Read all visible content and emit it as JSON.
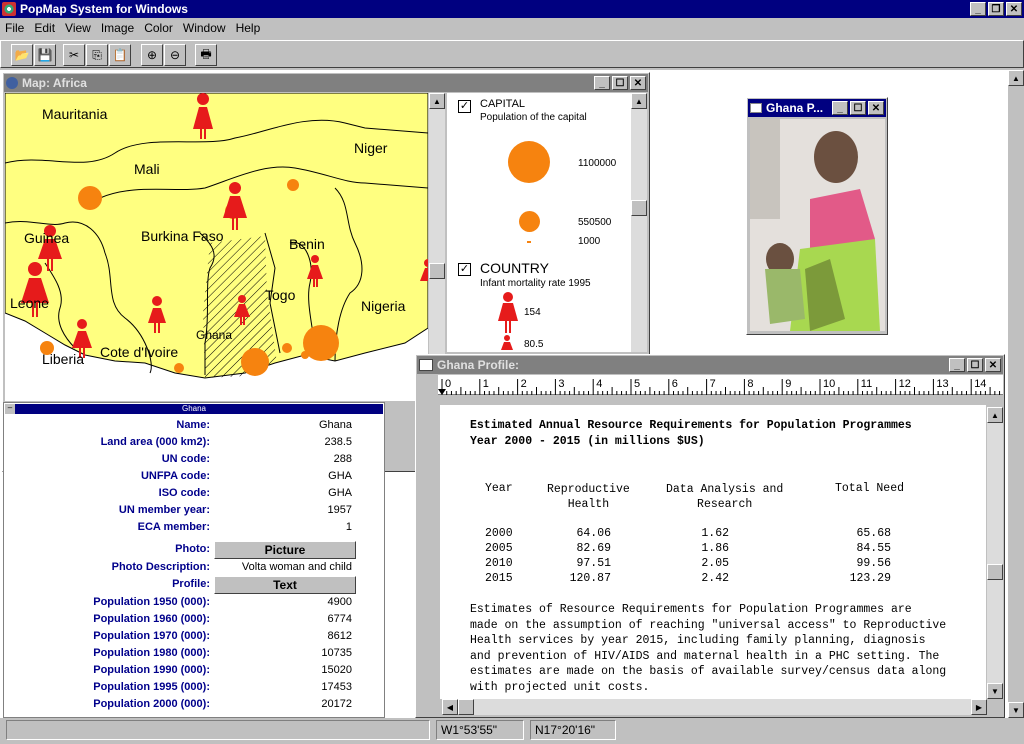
{
  "app": {
    "title": "PopMap System for Windows",
    "menu": [
      "File",
      "Edit",
      "View",
      "Image",
      "Color",
      "Window",
      "Help"
    ],
    "toolbar_icons": [
      "open-icon",
      "save-icon",
      "cut-icon",
      "copy-icon",
      "paste-icon",
      "zoom-in-icon",
      "zoom-out-icon",
      "print-icon"
    ]
  },
  "map_window": {
    "title": "Map: Africa",
    "labels": [
      "Mauritania",
      "Niger",
      "Mali",
      "Guinea",
      "Burkina Faso",
      "Benin",
      "Leone",
      "Togo",
      "Nigeria",
      "Ghana",
      "Cote d'Ivoire",
      "Liberia"
    ]
  },
  "legend": {
    "capital_title": "CAPITAL",
    "capital_sub": "Population of the capital",
    "capital_values": [
      "1100000",
      "550500",
      "1000"
    ],
    "country_title": "COUNTRY",
    "country_sub": "Infant mortality rate 1995",
    "country_values": [
      "154",
      "80.5"
    ]
  },
  "properties": {
    "title": "Ghana",
    "rows": [
      {
        "label": "Name:",
        "value": "Ghana"
      },
      {
        "label": "Land area (000 km2):",
        "value": "238.5"
      },
      {
        "label": "UN code:",
        "value": "288"
      },
      {
        "label": "UNFPA code:",
        "value": "GHA"
      },
      {
        "label": "ISO code:",
        "value": "GHA"
      },
      {
        "label": "UN member year:",
        "value": "1957"
      },
      {
        "label": "ECA member:",
        "value": "1"
      }
    ],
    "photo_label": "Photo:",
    "photo_button": "Picture",
    "photo_desc_label": "Photo Description:",
    "photo_desc_value": "Volta woman and child",
    "profile_label": "Profile:",
    "profile_button": "Text",
    "pop_rows": [
      {
        "label": "Population 1950 (000):",
        "value": "4900"
      },
      {
        "label": "Population 1960 (000):",
        "value": "6774"
      },
      {
        "label": "Population 1970 (000):",
        "value": "8612"
      },
      {
        "label": "Population 1980 (000):",
        "value": "10735"
      },
      {
        "label": "Population 1990 (000):",
        "value": "15020"
      },
      {
        "label": "Population 1995 (000):",
        "value": "17453"
      },
      {
        "label": "Population 2000 (000):",
        "value": "20172"
      }
    ]
  },
  "photo_window": {
    "title": "Ghana P..."
  },
  "profile_window": {
    "title": "Ghana Profile:",
    "ruler": [
      "0",
      "1",
      "2",
      "3",
      "4",
      "5",
      "6",
      "7",
      "8",
      "9",
      "10",
      "11",
      "12",
      "13",
      "14"
    ],
    "heading1": "Estimated Annual Resource Requirements for Population Programmes",
    "heading2": "Year 2000 - 2015 (in millions $US)",
    "col_headers": [
      "Year",
      "Reproductive\nHealth",
      "Data Analysis and\nResearch",
      "Total Need"
    ],
    "table": [
      [
        "2000",
        "64.06",
        "1.62",
        "65.68"
      ],
      [
        "2005",
        "82.69",
        "1.86",
        "84.55"
      ],
      [
        "2010",
        "97.51",
        "2.05",
        "99.56"
      ],
      [
        "2015",
        "120.87",
        "2.42",
        "123.29"
      ]
    ],
    "paragraph": [
      "Estimates of Resource Requirements for Population Programmes are",
      "made on the assumption of reaching \"universal access\" to Reproductive",
      "Health services by year 2015, including family planning, diagnosis",
      "and prevention of HIV/AIDS and maternal health in a PHC setting. The",
      "estimates are made on the basis of available survey/census data along",
      "with projected unit costs."
    ]
  },
  "status": {
    "longitude": "W1°53'55\"",
    "latitude": "N17°20'16\""
  },
  "colors": {
    "titlebar_active": "#000080",
    "titlebar_inactive": "#808080",
    "map_land": "#ffff80",
    "marker_red": "#e61b1b",
    "bubble_orange": "#f6830f"
  }
}
